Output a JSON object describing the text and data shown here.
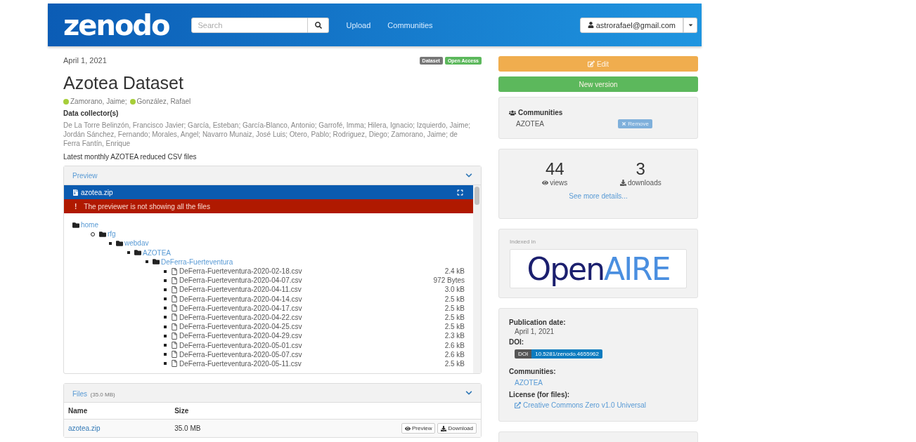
{
  "header": {
    "logo": "zenodo",
    "search": {
      "placeholder": "Search"
    },
    "nav": [
      "Upload",
      "Communities"
    ],
    "user": "astrorafael@gmail.com"
  },
  "record": {
    "date": "April 1, 2021",
    "badges": [
      {
        "label": "Dataset",
        "color": "#777777"
      },
      {
        "label": "Open Access",
        "color": "#5cb85c"
      }
    ],
    "title": "Azotea Dataset",
    "authors": [
      "Zamorano, Jaime;",
      "González, Rafael"
    ],
    "collectors_heading": "Data collector(s)",
    "collectors": "De La Torre Belinzón, Francisco Javier; García, Esteban; García-Blanco, Antonio; Garrofé, Imma; Hilera, Ignacio; Izquierdo, Jaime; Jordán Sánchez, Fernando; Morales, Angel; Navarro Munaiz, José Luis; Otero, Pablo; Rodriguez, Diego; Zamorano, Jaime; de Ferra Fantín, Enrique",
    "description": "Latest monthly AZOTEA reduced CSV files"
  },
  "preview": {
    "heading": "Preview",
    "expanded": true,
    "file": "azotea.zip",
    "warning_icon": "!",
    "warning": "The previewer is not showing all the files",
    "tree": [
      {
        "kind": "folder",
        "name": "home",
        "children": [
          {
            "kind": "folder",
            "name": "rfg",
            "children": [
              {
                "kind": "folder",
                "name": "webdav",
                "children": [
                  {
                    "kind": "folder",
                    "name": "AZOTEA",
                    "children": [
                      {
                        "kind": "folder",
                        "name": "DeFerra-Fuerteventura",
                        "children": [
                          {
                            "kind": "file",
                            "name": "DeFerra-Fuerteventura-2020-02-18.csv",
                            "size": "2.4 kB"
                          },
                          {
                            "kind": "file",
                            "name": "DeFerra-Fuerteventura-2020-04-07.csv",
                            "size": "972 Bytes"
                          },
                          {
                            "kind": "file",
                            "name": "DeFerra-Fuerteventura-2020-04-11.csv",
                            "size": "3.0 kB"
                          },
                          {
                            "kind": "file",
                            "name": "DeFerra-Fuerteventura-2020-04-14.csv",
                            "size": "2.5 kB"
                          },
                          {
                            "kind": "file",
                            "name": "DeFerra-Fuerteventura-2020-04-17.csv",
                            "size": "2.5 kB"
                          },
                          {
                            "kind": "file",
                            "name": "DeFerra-Fuerteventura-2020-04-22.csv",
                            "size": "2.5 kB"
                          },
                          {
                            "kind": "file",
                            "name": "DeFerra-Fuerteventura-2020-04-25.csv",
                            "size": "2.5 kB"
                          },
                          {
                            "kind": "file",
                            "name": "DeFerra-Fuerteventura-2020-04-29.csv",
                            "size": "2.3 kB"
                          },
                          {
                            "kind": "file",
                            "name": "DeFerra-Fuerteventura-2020-05-01.csv",
                            "size": "2.6 kB"
                          },
                          {
                            "kind": "file",
                            "name": "DeFerra-Fuerteventura-2020-05-07.csv",
                            "size": "2.6 kB"
                          },
                          {
                            "kind": "file",
                            "name": "DeFerra-Fuerteventura-2020-05-11.csv",
                            "size": "2.5 kB"
                          }
                        ]
                      }
                    ]
                  }
                ]
              }
            ]
          }
        ]
      }
    ]
  },
  "files": {
    "heading": "Files",
    "total": "(35.0 MB)",
    "expanded": true,
    "columns": [
      "Name",
      "Size"
    ],
    "rows": [
      {
        "name": "azotea.zip",
        "size": "35.0 MB",
        "actions": [
          "Preview",
          "Download"
        ]
      }
    ]
  },
  "sidebar": {
    "edit": "Edit",
    "new_version": "New version",
    "communities": {
      "heading": "Communities",
      "items": [
        {
          "name": "AZOTEA",
          "action": "Remove"
        }
      ]
    },
    "stats": [
      {
        "value": "44",
        "label": "views",
        "kind": "views"
      },
      {
        "value": "3",
        "label": "downloads",
        "kind": "downloads"
      }
    ],
    "more": "See more details...",
    "indexed": {
      "label": "Indexed in",
      "logo": [
        "Open",
        "AIRE"
      ]
    },
    "info": [
      {
        "label": "Publication date:",
        "kind": "text",
        "value": "April 1, 2021"
      },
      {
        "label": "DOI:",
        "kind": "doi",
        "prefix": "DOI",
        "value": "10.5281/zenodo.4655962"
      },
      {
        "label": "Communities:",
        "kind": "link",
        "value": "AZOTEA"
      },
      {
        "label": "License (for files):",
        "kind": "extlink",
        "value": "Creative Commons Zero v1.0 Universal"
      }
    ]
  }
}
